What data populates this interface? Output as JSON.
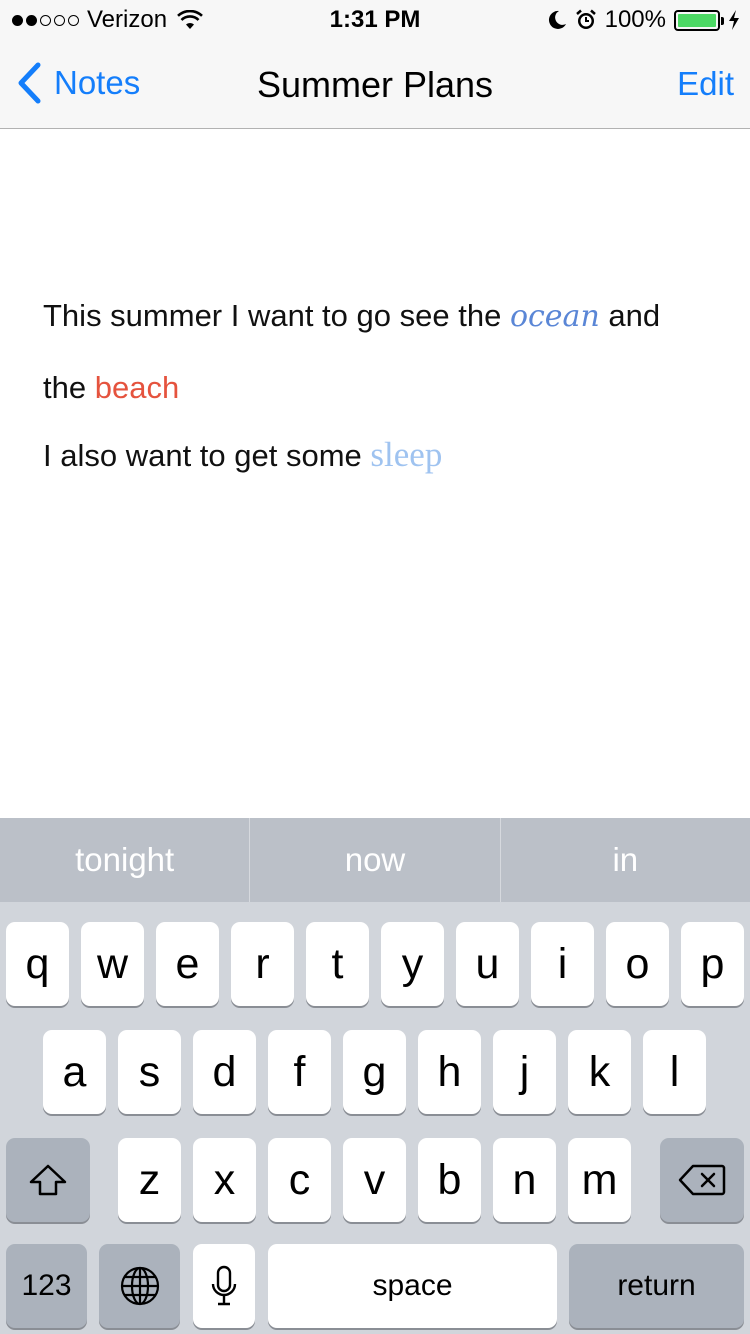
{
  "status_bar": {
    "carrier": "Verizon",
    "signal_bars": 2,
    "signal_total": 5,
    "time": "1:31 PM",
    "battery": "100%",
    "battery_level": 1.0,
    "icons": [
      "signal-dots-icon",
      "wifi-icon",
      "moon-icon",
      "alarm-icon",
      "battery-icon",
      "charging-bolt-icon"
    ],
    "battery_color": "#4cd964"
  },
  "nav": {
    "back_label": "Notes",
    "title": "Summer Plans",
    "edit_label": "Edit",
    "accent_color": "#147efb"
  },
  "note": {
    "line1_pre": "This summer I want to go see the ",
    "word_ocean": "ocean",
    "line1_post": " and",
    "line2_pre": "the ",
    "word_beach": "beach",
    "line3_pre": "I also want to get some ",
    "word_sleep": "sleep",
    "colors": {
      "ocean": "#5a86d6",
      "beach": "#e5533e",
      "sleep": "#9fc3f0"
    }
  },
  "keyboard": {
    "suggestions": [
      "tonight",
      "now",
      "in"
    ],
    "row1": [
      "q",
      "w",
      "e",
      "r",
      "t",
      "y",
      "u",
      "i",
      "o",
      "p"
    ],
    "row2": [
      "a",
      "s",
      "d",
      "f",
      "g",
      "h",
      "j",
      "k",
      "l"
    ],
    "row3": [
      "z",
      "x",
      "c",
      "v",
      "b",
      "n",
      "m"
    ],
    "numbers_label": "123",
    "space_label": "space",
    "return_label": "return",
    "icons": [
      "shift-icon",
      "delete-icon",
      "globe-icon",
      "microphone-icon"
    ]
  }
}
